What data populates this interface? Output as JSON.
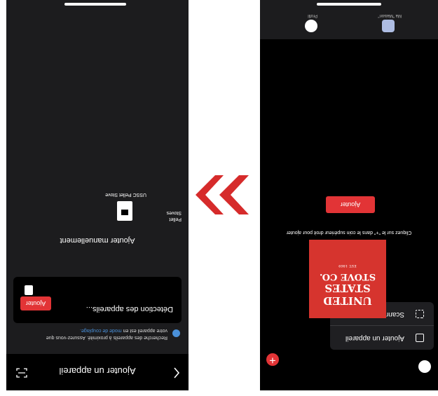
{
  "left_screen": {
    "header": {
      "title": "Ajouter un appareil"
    },
    "info": {
      "line1": "Recherche des appareils à proximité. Assurez-vous que",
      "line2_pre": "votre appareil est en ",
      "line2_link": "mode de couplage."
    },
    "detection_card": {
      "text": "Détection des appareils...",
      "button_label": "Ajouter"
    },
    "manual_heading": "Ajouter manuellement",
    "product": {
      "category_label_line1": "Pellet",
      "category_label_line2": "Stoves",
      "caption": "USSC Pellet Stove"
    }
  },
  "right_screen": {
    "tab_bar": {
      "home_label": "Ma \"Maison\"",
      "profile_label": "Profil"
    },
    "menu": {
      "add_device": "Ajouter un appareil",
      "scan_qr": "Scanner le QR code"
    },
    "logo": {
      "line1": "UNITED",
      "line2": "STATES",
      "line3": "STOVE CO.",
      "line4": "EST. 1869"
    },
    "hint": "Cliquez sur le \"+\" dans le coin supérieur droit pour ajouter",
    "add_button_label": "Ajouter"
  },
  "colors": {
    "accent_red": "#e23436",
    "card_dark": "#1c1c1e",
    "link_blue": "#4a90d9"
  },
  "icons": {
    "back": "chevron-left-icon",
    "scan": "scan-icon",
    "add": "plus-icon",
    "gear": "gear-icon",
    "home": "home-icon",
    "profile": "profile-icon"
  }
}
